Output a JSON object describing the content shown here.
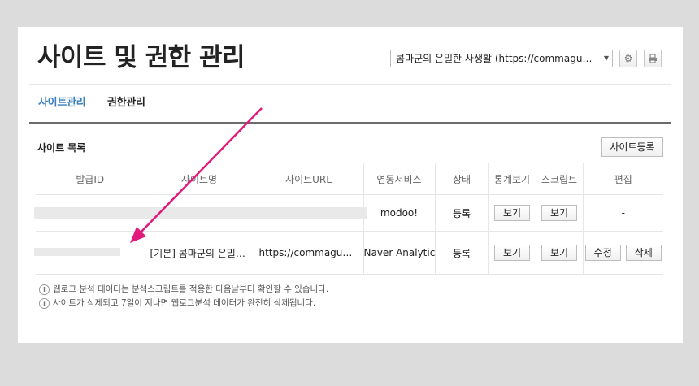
{
  "header": {
    "title": "사이트 및 권한 관리",
    "site_select_value": "콤마군의 은밀한 사생활 (https://commagun.com)",
    "settings_icon": "gear-icon",
    "print_icon": "print-icon"
  },
  "tabs": [
    {
      "label": "사이트관리",
      "active": true
    },
    {
      "label": "권한관리",
      "active": false
    }
  ],
  "section": {
    "title": "사이트 목록",
    "register_label": "사이트등록"
  },
  "table": {
    "columns": [
      "발급ID",
      "사이트명",
      "사이트URL",
      "연동서비스",
      "상태",
      "통계보기",
      "스크립트",
      "편집"
    ],
    "rows": [
      {
        "id": "",
        "site_name": "",
        "site_url": "",
        "service": "modoo!",
        "status": "등록",
        "stats_label": "보기",
        "script_label": "보기",
        "edit": "-"
      },
      {
        "id": "",
        "site_name": "[기본] 콤마군의 은밀한 사생활",
        "site_url": "https://commagun.com",
        "service": "Naver Analytics",
        "status": "등록",
        "stats_label": "보기",
        "script_label": "보기",
        "edit_label": "수정",
        "delete_label": "삭제"
      }
    ]
  },
  "notes": [
    "웹로그 분석 데이터는 분석스크립트를 적용한 다음날부터 확인할 수 있습니다.",
    "사이트가 삭제되고 7일이 지나면 웹로그분석 데이터가 완전히 삭제됩니다."
  ],
  "colors": {
    "accent": "#3a7fc1",
    "annotation_arrow": "#e0197a"
  }
}
